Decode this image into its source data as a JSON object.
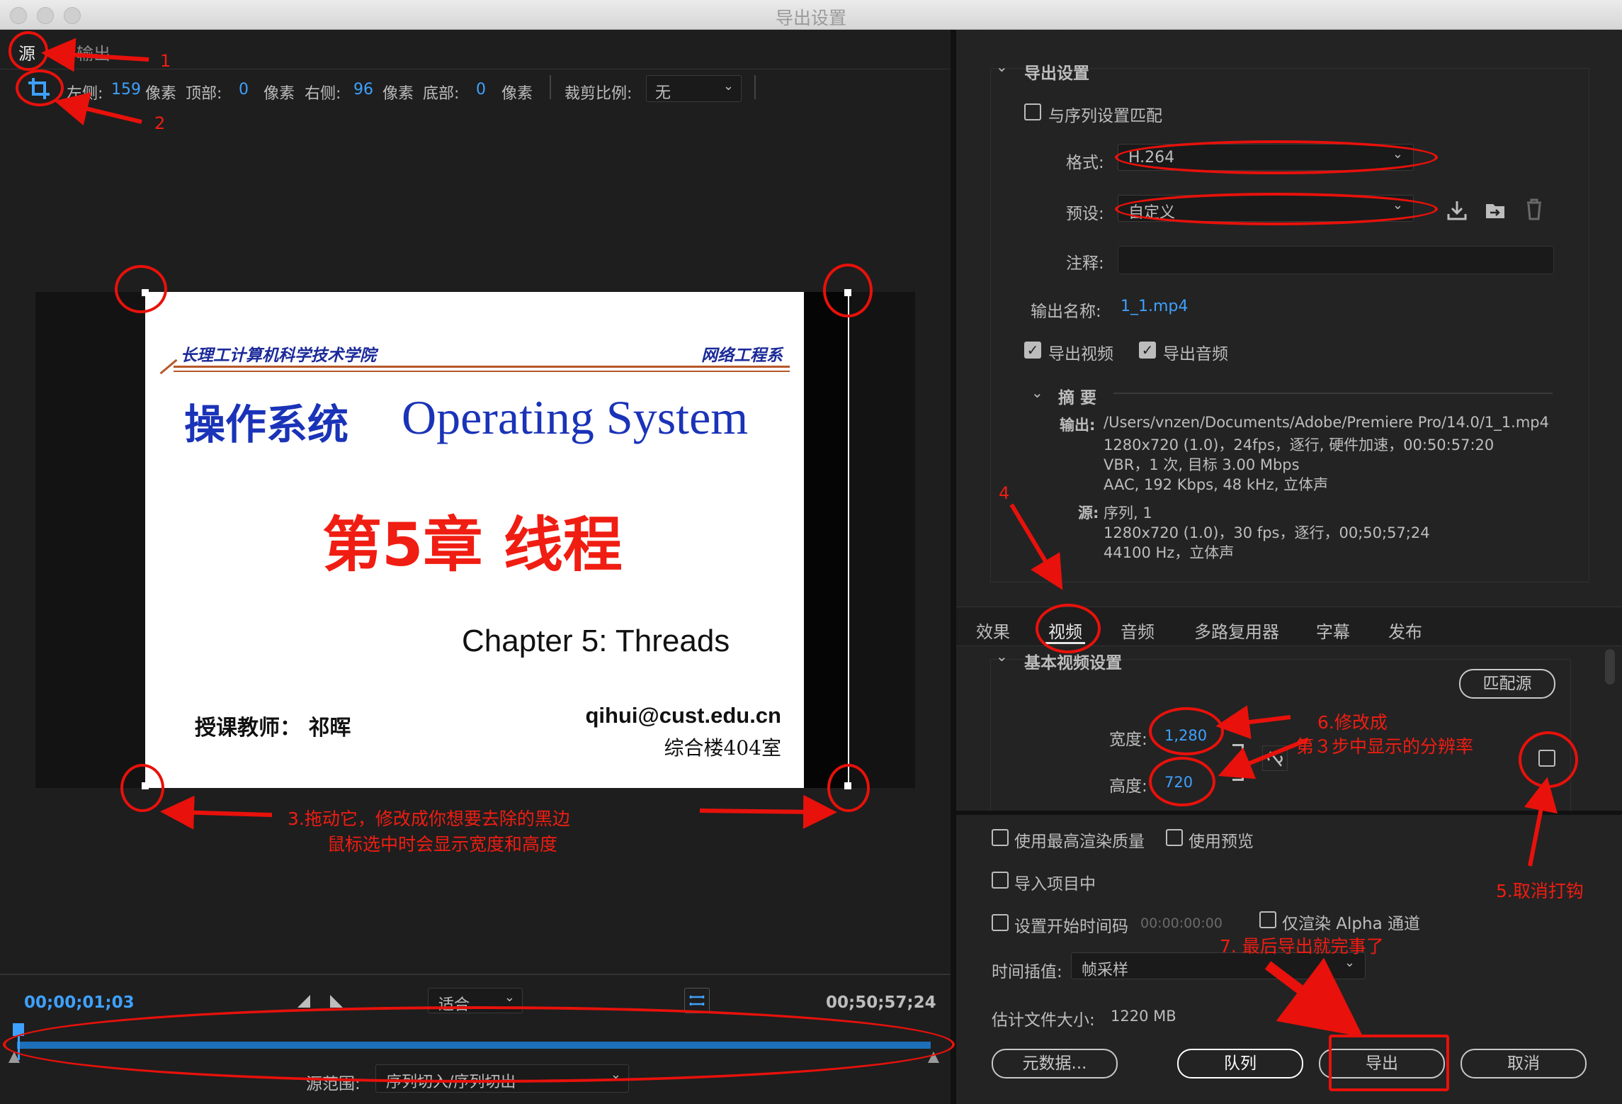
{
  "window": {
    "title": "导出设置"
  },
  "source": {
    "tab_source": "源",
    "tab_output": "输出",
    "crop_left_label": "左侧:",
    "crop_left_value": "159",
    "unit": "像素",
    "crop_top_label": "顶部:",
    "crop_top_value": "0",
    "crop_right_label": "右侧:",
    "crop_right_value": "96",
    "crop_bottom_label": "底部:",
    "crop_bottom_value": "0",
    "crop_ratio_label": "裁剪比例:",
    "crop_ratio_value": "无"
  },
  "slide": {
    "header_left": "长理工计算机科学技术学院",
    "header_right": "网络工程系",
    "title_cn": "操作系统",
    "title_en": "Operating System",
    "chapter_cn": "第5章 线程",
    "chapter_en": "Chapter 5: Threads",
    "teacher": "授课教师： 祁晖",
    "email": "qihui@cust.edu.cn",
    "room": "综合楼404室"
  },
  "timeline": {
    "current_time": "00;00;01;03",
    "end_time": "00;50;57;24",
    "fit_label": "适合",
    "range_label": "源范围:",
    "range_value": "序列切入/序列切出",
    "progress": 0.0
  },
  "annotations": {
    "n1": "1",
    "n2": "2",
    "n4": "4",
    "n3_line1": "3.拖动它，修改成你想要去除的黑边",
    "n3_line2": "鼠标选中时会显示宽度和高度",
    "n5": "5.取消打钩",
    "n6_line1": "6.修改成",
    "n6_line2": "第３步中显示的分辨率",
    "n7": "7. 最后导出就完事了"
  },
  "export_settings": {
    "section": "导出设置",
    "match_sequence": "与序列设置匹配",
    "format_label": "格式:",
    "format_value": "H.264",
    "preset_label": "预设:",
    "preset_value": "自定义",
    "comment_label": "注释:",
    "comment_value": "",
    "output_name_label": "输出名称:",
    "output_name_value": "1_1.mp4",
    "export_video": "导出视频",
    "export_audio": "导出音频",
    "summary_title": "摘 要",
    "out_label": "输出:",
    "out_line1": "/Users/vnzen/Documents/Adobe/Premiere Pro/14.0/1_1.mp4",
    "out_line2": "1280x720 (1.0)，24fps，逐行, 硬件加速，00:50:57:20",
    "out_line3": "VBR，1 次, 目标 3.00 Mbps",
    "out_line4": "AAC, 192 Kbps, 48  kHz, 立体声",
    "src_label": "源:",
    "src_line1": "序列, 1",
    "src_line2": "1280x720 (1.0)，30 fps，逐行，00;50;57;24",
    "src_line3": "44100 Hz，立体声"
  },
  "tabs": [
    "效果",
    "视频",
    "音频",
    "多路复用器",
    "字幕",
    "发布"
  ],
  "video": {
    "section": "基本视频设置",
    "match_source": "匹配源",
    "width_label": "宽度:",
    "width_value": "1,280",
    "height_label": "高度:",
    "height_value": "720"
  },
  "bottom": {
    "max_quality": "使用最高渲染质量",
    "use_preview": "使用预览",
    "import_project": "导入项目中",
    "set_start": "设置开始时间码",
    "start_tc": "00:00:00:00",
    "alpha_only": "仅渲染 Alpha 通道",
    "interp_label": "时间插值:",
    "interp_value": "帧采样",
    "size_label": "估计文件大小:",
    "size_value": "1220 MB",
    "metadata_btn": "元数据...",
    "queue_btn": "队列",
    "export_btn": "导出",
    "cancel_btn": "取消"
  },
  "colors": {
    "accent": "#3ea1ff",
    "annotation": "#e8110b",
    "bg": "#232323"
  }
}
